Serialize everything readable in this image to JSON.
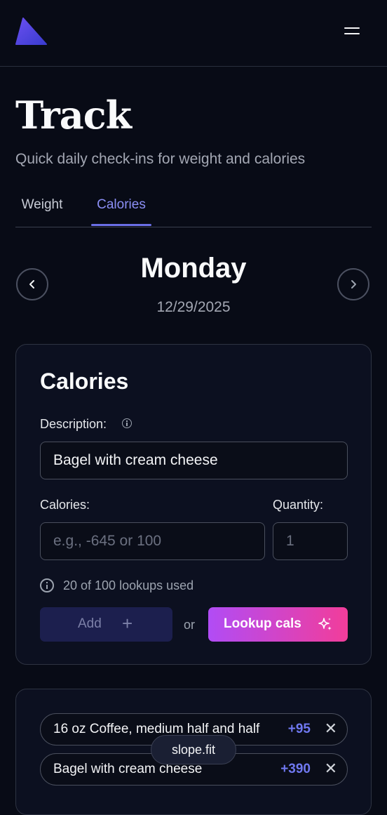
{
  "header": {
    "logo_icon": "triangle-logo-icon",
    "menu_icon": "hamburger-menu-icon"
  },
  "page": {
    "title": "Track",
    "subtitle": "Quick daily check-ins for weight and calories"
  },
  "tabs": [
    {
      "label": "Weight",
      "active": false
    },
    {
      "label": "Calories",
      "active": true
    }
  ],
  "day": {
    "name": "Monday",
    "date": "12/29/2025",
    "prev_icon": "chevron-left-icon",
    "next_icon": "chevron-right-icon"
  },
  "calories_form": {
    "title": "Calories",
    "description_label": "Description:",
    "description_value": "Bagel with cream cheese",
    "calories_label": "Calories:",
    "calories_placeholder": "e.g., -645 or 100",
    "quantity_label": "Quantity:",
    "quantity_placeholder": "1",
    "lookup_usage": "20 of 100 lookups used",
    "add_label": "Add",
    "add_icon": "+",
    "or_text": "or",
    "lookup_label": "Lookup cals",
    "lookup_icon": "sparkles-icon"
  },
  "entries": [
    {
      "description": "16 oz Coffee, medium half and half",
      "calories": "+95",
      "remove": "✕"
    },
    {
      "description": "Bagel with cream cheese",
      "calories": "+390",
      "remove": "✕"
    }
  ],
  "toast": {
    "text": "slope.fit"
  },
  "colors": {
    "background": "#080b16",
    "accent": "#6b6fe6",
    "lookup_gradient_start": "#b14cf5",
    "lookup_gradient_end": "#f23d9a"
  }
}
